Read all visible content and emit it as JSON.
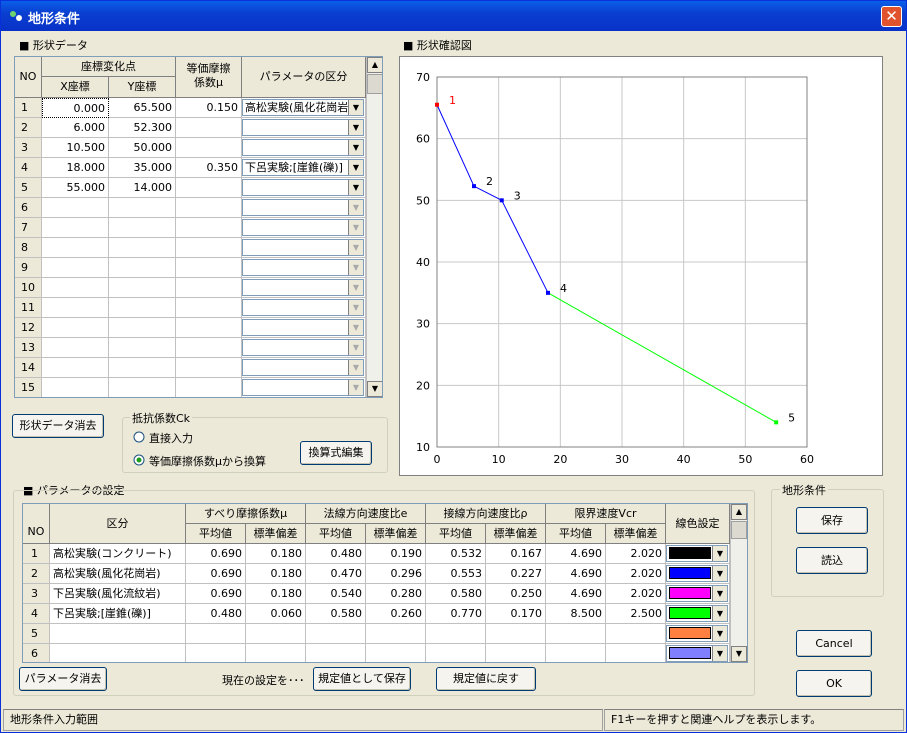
{
  "window": {
    "title": "地形条件",
    "close_symbol": "✕"
  },
  "shape_data": {
    "section_title": "■ 形状データ",
    "headers": {
      "no": "NO",
      "coord_group": "座標変化点",
      "x": "X座標",
      "y": "Y座標",
      "mu": "等価摩擦\n係数μ",
      "param": "パラメータの区分"
    },
    "rows": [
      {
        "no": "1",
        "x": "0.000",
        "y": "65.500",
        "mu": "0.150",
        "param": "高松実験(風化花崗岩)"
      },
      {
        "no": "2",
        "x": "6.000",
        "y": "52.300",
        "mu": "",
        "param": ""
      },
      {
        "no": "3",
        "x": "10.500",
        "y": "50.000",
        "mu": "",
        "param": ""
      },
      {
        "no": "4",
        "x": "18.000",
        "y": "35.000",
        "mu": "0.350",
        "param": "下呂実験;[崖錐(礫)]"
      },
      {
        "no": "5",
        "x": "55.000",
        "y": "14.000",
        "mu": "",
        "param": ""
      },
      {
        "no": "6",
        "x": "",
        "y": "",
        "mu": "",
        "param": ""
      },
      {
        "no": "7",
        "x": "",
        "y": "",
        "mu": "",
        "param": ""
      },
      {
        "no": "8",
        "x": "",
        "y": "",
        "mu": "",
        "param": ""
      },
      {
        "no": "9",
        "x": "",
        "y": "",
        "mu": "",
        "param": ""
      },
      {
        "no": "10",
        "x": "",
        "y": "",
        "mu": "",
        "param": ""
      },
      {
        "no": "11",
        "x": "",
        "y": "",
        "mu": "",
        "param": ""
      },
      {
        "no": "12",
        "x": "",
        "y": "",
        "mu": "",
        "param": ""
      },
      {
        "no": "13",
        "x": "",
        "y": "",
        "mu": "",
        "param": ""
      },
      {
        "no": "14",
        "x": "",
        "y": "",
        "mu": "",
        "param": ""
      },
      {
        "no": "15",
        "x": "",
        "y": "",
        "mu": "",
        "param": ""
      }
    ],
    "clear_button": "形状データ消去"
  },
  "resistance": {
    "group_title": "抵抗係数Ck",
    "option_direct": "直接入力",
    "option_convert": "等価摩擦係数μから換算",
    "selected": "convert",
    "edit_button": "換算式編集"
  },
  "chart_section_title": "■ 形状確認図",
  "chart_data": {
    "type": "line",
    "xlim": [
      0,
      60
    ],
    "ylim": [
      10,
      70
    ],
    "xticks": [
      "0",
      "10",
      "20",
      "30",
      "40",
      "50",
      "60"
    ],
    "yticks": [
      "10",
      "20",
      "30",
      "40",
      "50",
      "60",
      "70"
    ],
    "points": [
      {
        "label": "1",
        "x": 0,
        "y": 65.5
      },
      {
        "label": "2",
        "x": 6,
        "y": 52.3
      },
      {
        "label": "3",
        "x": 10.5,
        "y": 50
      },
      {
        "label": "4",
        "x": 18,
        "y": 35
      },
      {
        "label": "5",
        "x": 55,
        "y": 14
      }
    ],
    "segment_colors": [
      "#0000ff",
      "#0000ff",
      "#0000ff",
      "#00ff00"
    ],
    "start_point_color": "#ff0000",
    "grid": true
  },
  "params": {
    "section_title": "■ パラメータの設定",
    "headers": {
      "no": "NO",
      "kubun": "区分",
      "slip": "すべり摩擦係数μ",
      "normal": "法線方向速度比e",
      "tangent": "接線方向速度比ρ",
      "limit": "限界速度Vcr",
      "mean": "平均値",
      "sd": "標準偏差",
      "color": "線色設定"
    },
    "rows": [
      {
        "no": "1",
        "name": "高松実験(コンクリート)",
        "slip_m": "0.690",
        "slip_s": "0.180",
        "nor_m": "0.480",
        "nor_s": "0.190",
        "tan_m": "0.532",
        "tan_s": "0.167",
        "lim_m": "4.690",
        "lim_s": "2.020",
        "color": "#000000"
      },
      {
        "no": "2",
        "name": "高松実験(風化花崗岩)",
        "slip_m": "0.690",
        "slip_s": "0.180",
        "nor_m": "0.470",
        "nor_s": "0.296",
        "tan_m": "0.553",
        "tan_s": "0.227",
        "lim_m": "4.690",
        "lim_s": "2.020",
        "color": "#0000ff"
      },
      {
        "no": "3",
        "name": "下呂実験(風化流紋岩)",
        "slip_m": "0.690",
        "slip_s": "0.180",
        "nor_m": "0.540",
        "nor_s": "0.280",
        "tan_m": "0.580",
        "tan_s": "0.250",
        "lim_m": "4.690",
        "lim_s": "2.020",
        "color": "#ff00ff"
      },
      {
        "no": "4",
        "name": "下呂実験;[崖錐(礫)]",
        "slip_m": "0.480",
        "slip_s": "0.060",
        "nor_m": "0.580",
        "nor_s": "0.260",
        "tan_m": "0.770",
        "tan_s": "0.170",
        "lim_m": "8.500",
        "lim_s": "2.500",
        "color": "#00ff00"
      },
      {
        "no": "5",
        "name": "",
        "slip_m": "",
        "slip_s": "",
        "nor_m": "",
        "nor_s": "",
        "tan_m": "",
        "tan_s": "",
        "lim_m": "",
        "lim_s": "",
        "color": "#ff8040"
      },
      {
        "no": "6",
        "name": "",
        "slip_m": "",
        "slip_s": "",
        "nor_m": "",
        "nor_s": "",
        "tan_m": "",
        "tan_s": "",
        "lim_m": "",
        "lim_s": "",
        "color": "#8080ff"
      }
    ],
    "clear_button": "パラメータ消去",
    "current_label": "現在の設定を･･･",
    "save_default_button": "規定値として保存",
    "restore_default_button": "規定値に戻す"
  },
  "terrain": {
    "group_title": "地形条件",
    "save_button": "保存",
    "load_button": "読込"
  },
  "dialog": {
    "cancel_button": "Cancel",
    "ok_button": "OK"
  },
  "status": {
    "left": "地形条件入力範囲",
    "right": "F1キーを押すと関連ヘルプを表示します。"
  }
}
